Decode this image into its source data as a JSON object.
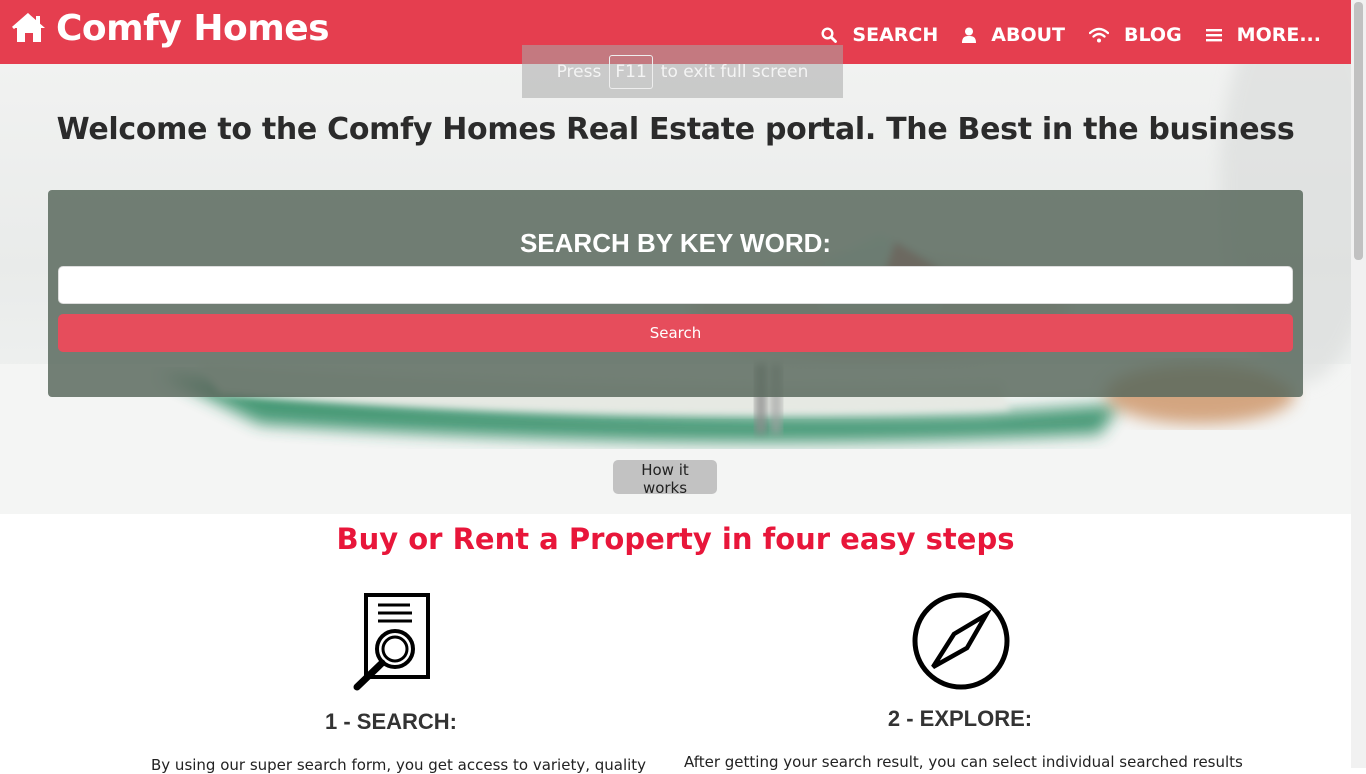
{
  "navbar": {
    "brand": "Comfy Homes",
    "brand_icon": "home-icon",
    "brand_color": "#e53e4f",
    "links": [
      {
        "label": "SEARCH",
        "icon": "search-icon"
      },
      {
        "label": "ABOUT",
        "icon": "user-icon"
      },
      {
        "label": "BLOG",
        "icon": "wifi-icon"
      },
      {
        "label": "MORE...",
        "icon": "menu-icon"
      }
    ]
  },
  "fullscreen_notice": {
    "before": "Press",
    "key": "F11",
    "after": "to exit full screen"
  },
  "hero": {
    "title": "Welcome to the Comfy Homes Real Estate portal. The Best in the business",
    "search_heading": "SEARCH BY KEY WORD:",
    "search_value": "",
    "search_placeholder": "",
    "search_button": "Search",
    "how_button": "How it works"
  },
  "steps": {
    "title": "Buy or Rent a Property in four easy steps",
    "title_color": "#e8163a",
    "items": [
      {
        "icon": "document-search-icon",
        "title": "1 - SEARCH:",
        "text": "By using our super search form, you get access to variety, quality"
      },
      {
        "icon": "compass-icon",
        "title": "2 - EXPLORE:",
        "text": "After getting your search result, you can select individual searched results"
      }
    ]
  }
}
